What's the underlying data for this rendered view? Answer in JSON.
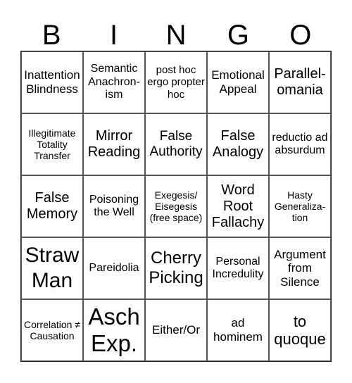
{
  "header": {
    "letters": [
      "B",
      "I",
      "N",
      "G",
      "O"
    ]
  },
  "cells": [
    [
      "Inattention Blindness",
      "Semantic Anachron-ism",
      "post hoc ergo propter hoc",
      "Emotional Appeal",
      "Parallel-omania"
    ],
    [
      "Illegitimate Totality Transfer",
      "Mirror Reading",
      "False Authority",
      "False Analogy",
      "reductio ad absurdum"
    ],
    [
      "False Memory",
      "Poisoning the Well",
      "Exegesis/ Eisegesis (free space)",
      "Word Root Fallachy",
      "Hasty Generaliza-tion"
    ],
    [
      "Straw Man",
      "Pareidolia",
      "Cherry Picking",
      "Personal Incredulity",
      "Argument from Silence"
    ],
    [
      "Correlation ≠ Causation",
      "Asch Exp.",
      "Either/Or",
      "ad hominem",
      "to quoque"
    ]
  ]
}
